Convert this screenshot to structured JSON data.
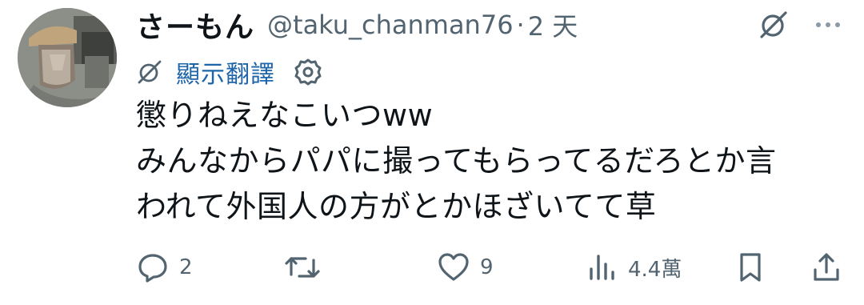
{
  "author": {
    "display_name": "さーもん",
    "handle": "@taku_chanman76",
    "separator": "·",
    "time": "2 天"
  },
  "translate": {
    "label": "顯示翻譯"
  },
  "tweet": {
    "lines": [
      "懲りねえなこいつww",
      "みんなからパパに撮ってもらってるだろとか言",
      "われて外国人の方がとかほざいてて草"
    ]
  },
  "actions": {
    "replies": "2",
    "retweets": "",
    "likes": "9",
    "views": "4.4萬"
  },
  "icons": {
    "top_right": [
      "grok-slash-icon",
      "more-icon"
    ],
    "translate_row": [
      "grok-slash-icon",
      "gear-icon"
    ],
    "actions": [
      "reply-icon",
      "retweet-icon",
      "like-icon",
      "views-icon",
      "bookmark-icon",
      "share-icon"
    ]
  },
  "colors": {
    "text": "#0f1419",
    "muted": "#536471",
    "link": "#1d64a8",
    "background": "#ffffff"
  }
}
